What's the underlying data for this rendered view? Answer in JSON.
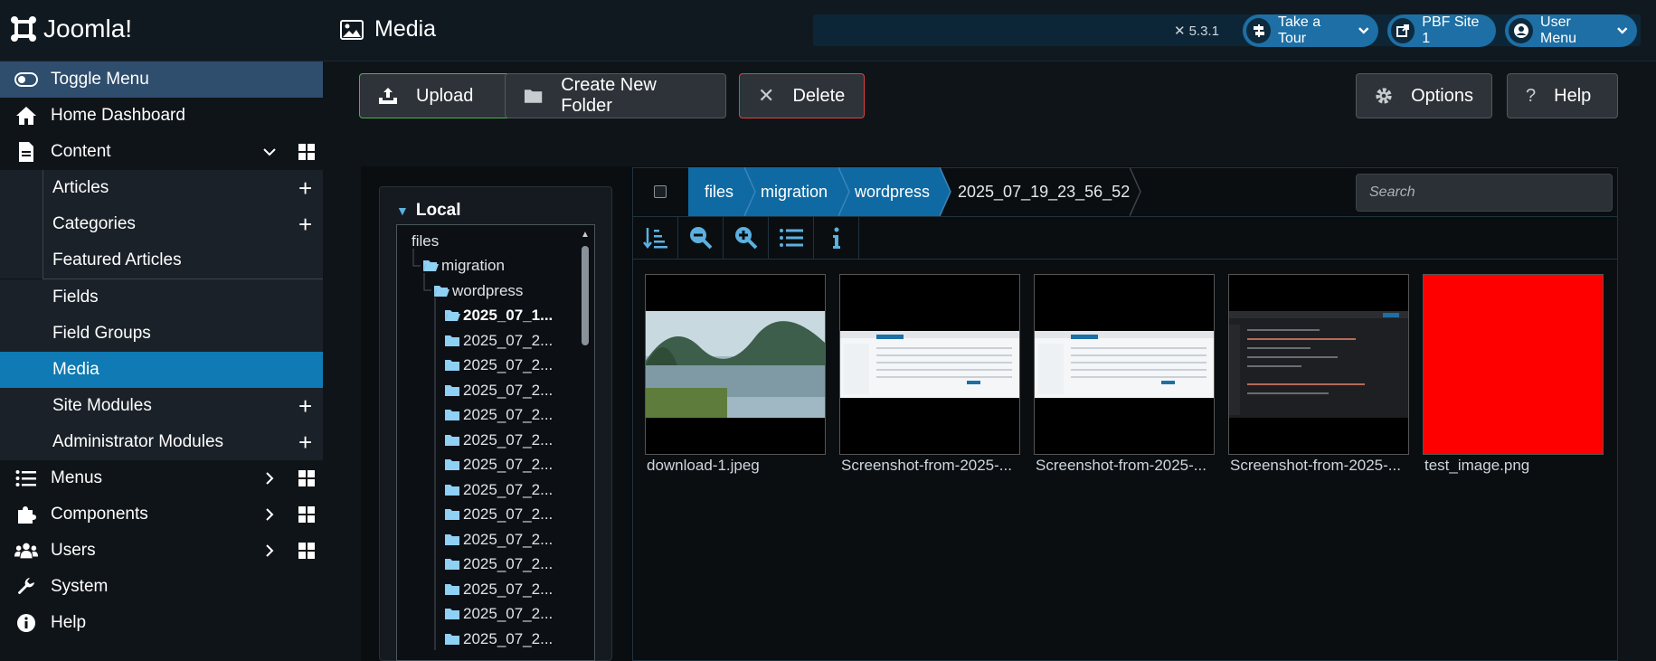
{
  "header": {
    "brand": "Joomla!",
    "page_title": "Media",
    "version": "5.3.1",
    "take_tour": "Take a Tour",
    "site_link": "PBF Site 1",
    "user_menu": "User Menu"
  },
  "sidebar": {
    "toggle": "Toggle Menu",
    "home": "Home Dashboard",
    "content": "Content",
    "articles": "Articles",
    "categories": "Categories",
    "featured": "Featured Articles",
    "fields": "Fields",
    "field_groups": "Field Groups",
    "media": "Media",
    "site_modules": "Site Modules",
    "admin_modules": "Administrator Modules",
    "menus": "Menus",
    "components": "Components",
    "users": "Users",
    "system": "System",
    "help": "Help"
  },
  "toolbar": {
    "upload": "Upload",
    "new_folder": "Create New Folder",
    "delete": "Delete",
    "options": "Options",
    "help": "Help"
  },
  "tree": {
    "title": "Local",
    "items": [
      "files",
      "migration",
      "wordpress",
      "2025_07_1...",
      "2025_07_2...",
      "2025_07_2...",
      "2025_07_2...",
      "2025_07_2...",
      "2025_07_2...",
      "2025_07_2...",
      "2025_07_2...",
      "2025_07_2...",
      "2025_07_2...",
      "2025_07_2...",
      "2025_07_2...",
      "2025_07_2...",
      "2025_07_2..."
    ]
  },
  "breadcrumb": [
    "files",
    "migration",
    "wordpress",
    "2025_07_19_23_56_52"
  ],
  "search": {
    "placeholder": "Search"
  },
  "files": [
    {
      "name": "download-1.jpeg",
      "kind": "landscape"
    },
    {
      "name": "Screenshot-from-2025-...",
      "kind": "screenshot-light"
    },
    {
      "name": "Screenshot-from-2025-...",
      "kind": "screenshot-light"
    },
    {
      "name": "Screenshot-from-2025-...",
      "kind": "screenshot-dark"
    },
    {
      "name": "test_image.png",
      "kind": "red"
    }
  ],
  "colors": {
    "accent": "#0f7ab3",
    "breadcrumb": "#0f6aa3",
    "toggle_bg": "#2f4d6d"
  }
}
